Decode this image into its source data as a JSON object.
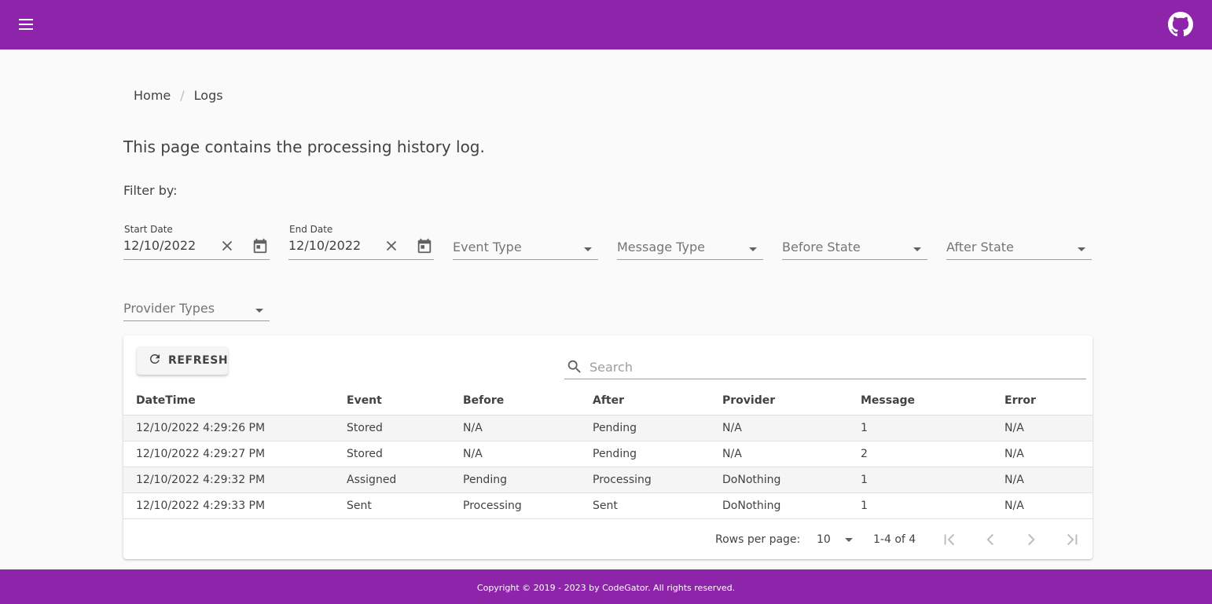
{
  "appbar": {
    "menu_icon": "hamburger-menu-icon",
    "github_icon": "github-icon",
    "brand_color": "#8e24aa"
  },
  "breadcrumb": {
    "home": "Home",
    "separator": "/",
    "current": "Logs"
  },
  "intro": "This page contains the processing history log.",
  "filter_label": "Filter by:",
  "filters": {
    "start_date": {
      "label": "Start Date",
      "value": "12/10/2022"
    },
    "end_date": {
      "label": "End Date",
      "value": "12/10/2022"
    },
    "event_type": {
      "placeholder": "Event Type"
    },
    "message_type": {
      "placeholder": "Message Type"
    },
    "before_state": {
      "placeholder": "Before State"
    },
    "after_state": {
      "placeholder": "After State"
    },
    "provider_types": {
      "placeholder": "Provider Types"
    }
  },
  "toolbar": {
    "refresh_label": "REFRESH",
    "search_placeholder": "Search"
  },
  "table": {
    "columns": [
      "DateTime",
      "Event",
      "Before",
      "After",
      "Provider",
      "Message",
      "Error"
    ],
    "rows": [
      [
        "12/10/2022 4:29:26 PM",
        "Stored",
        "N/A",
        "Pending",
        "N/A",
        "1",
        "N/A"
      ],
      [
        "12/10/2022 4:29:27 PM",
        "Stored",
        "N/A",
        "Pending",
        "N/A",
        "2",
        "N/A"
      ],
      [
        "12/10/2022 4:29:32 PM",
        "Assigned",
        "Pending",
        "Processing",
        "DoNothing",
        "1",
        "N/A"
      ],
      [
        "12/10/2022 4:29:33 PM",
        "Sent",
        "Processing",
        "Sent",
        "DoNothing",
        "1",
        "N/A"
      ]
    ]
  },
  "pager": {
    "rows_per_page_label": "Rows per page:",
    "rows_per_page": "10",
    "range": "1-4 of 4"
  },
  "footer": "Copyright © 2019 - 2023 by CodeGator. All rights reserved."
}
